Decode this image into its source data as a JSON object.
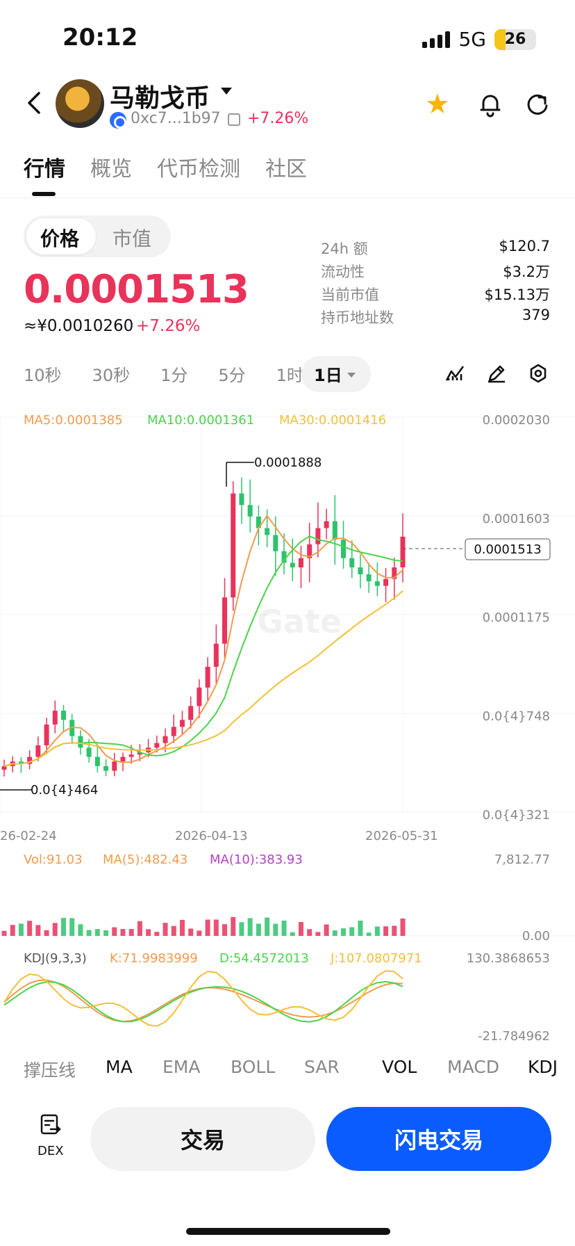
{
  "status": {
    "time": "20:12",
    "network": "5G",
    "battery": "26"
  },
  "header": {
    "name": "马勒戈币",
    "address": "0xc7...1b97",
    "change": "+7.26%"
  },
  "tabs": [
    "行情",
    "概览",
    "代币检测",
    "社区"
  ],
  "price_toggle": [
    "价格",
    "市值"
  ],
  "price": {
    "value": "0.0001513",
    "cny": "≈¥0.0010260",
    "change": "+7.26%"
  },
  "stats": [
    {
      "label": "24h  额",
      "value": "$120.7"
    },
    {
      "label": "流动性",
      "value": "$3.2万"
    },
    {
      "label": "当前市值",
      "value": "$15.13万"
    },
    {
      "label": "持币地址数",
      "value": "379"
    }
  ],
  "intervals": [
    "10秒",
    "30秒",
    "1分",
    "5分",
    "1时"
  ],
  "interval_active": "1日",
  "chart_data": {
    "type": "candlestick",
    "ma_legend": [
      "MA5:0.0001385",
      "MA10:0.0001361",
      "MA30:0.0001416"
    ],
    "y_ticks": [
      "0.0002030",
      "0.0001603",
      "0.0001175",
      "0.0{4}748",
      "0.0{4}321"
    ],
    "x_ticks": [
      "26-02-24",
      "2026-04-13",
      "2026-05-31"
    ],
    "high_label": "0.0001888",
    "low_label": "0.0{4}464",
    "last_price": "0.0001513",
    "vol_legend": [
      "Vol:91.03",
      "MA(5):482.43",
      "MA(10):383.93"
    ],
    "vol_ticks": [
      "7,812.77",
      "0.00"
    ],
    "kdj_legend": [
      "KDJ(9,3,3)",
      "K:71.9983999",
      "D:54.4572013",
      "J:107.0807971"
    ],
    "kdj_ticks": [
      "130.3868653",
      "-21.784962"
    ],
    "close": [
      5.2e-05,
      5.4e-05,
      5.3e-05,
      5.6e-05,
      6.1e-05,
      7e-05,
      7.6e-05,
      7.2e-05,
      6.5e-05,
      6e-05,
      5.6e-05,
      5.2e-05,
      5e-05,
      5.4e-05,
      5.6e-05,
      5.7e-05,
      5.8e-05,
      6e-05,
      6.2e-05,
      6.5e-05,
      6.9e-05,
      7.2e-05,
      7.8e-05,
      8.6e-05,
      9.5e-05,
      0.000105,
      0.000125,
      0.00017,
      0.000165,
      0.00016,
      0.000155,
      0.000152,
      0.000145,
      0.00014,
      0.000138,
      0.000142,
      0.000148,
      0.000155,
      0.000158,
      0.00015,
      0.000142,
      0.000138,
      0.000135,
      0.000132,
      0.00013,
      0.000133,
      0.000138,
      0.0001513
    ]
  },
  "indicator_tabs": [
    "撑压线",
    "MA",
    "EMA",
    "BOLL",
    "SAR",
    "VOL",
    "MACD",
    "KDJ"
  ],
  "footer": {
    "dex_label": "DEX",
    "trade": "交易",
    "flash_trade": "闪电交易"
  },
  "colors": {
    "up": "#e8335a",
    "down": "#2cc36b",
    "ma5": "#f29b4b",
    "ma10": "#4bd34b",
    "ma30": "#f2c038",
    "accent": "#0a5cff"
  }
}
